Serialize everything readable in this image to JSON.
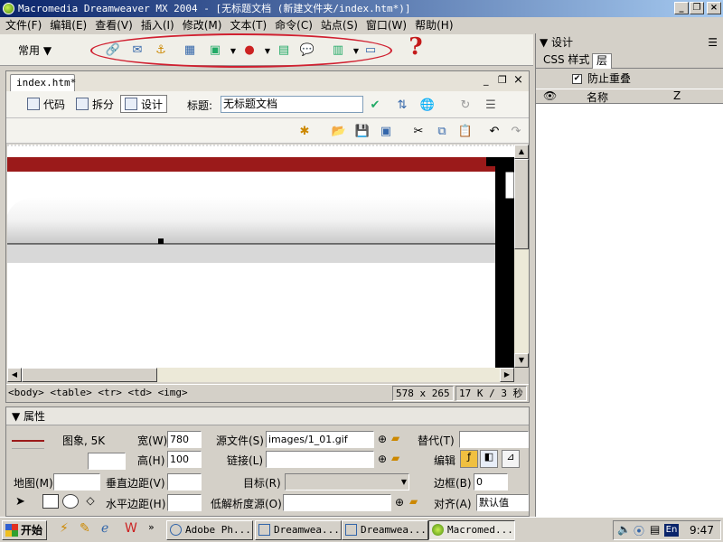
{
  "window": {
    "title": "Macromedia Dreamweaver MX 2004 - [无标题文档 (新建文件夹/index.htm*)]"
  },
  "menu": [
    "文件(F)",
    "编辑(E)",
    "查看(V)",
    "插入(I)",
    "修改(M)",
    "文本(T)",
    "命令(C)",
    "站点(S)",
    "窗口(W)",
    "帮助(H)"
  ],
  "insert_bar": {
    "category": "常用"
  },
  "document": {
    "tab": "index.htm*",
    "views": {
      "code": "代码",
      "split": "拆分",
      "design": "设计"
    },
    "title_label": "标题:",
    "title_value": "无标题文档",
    "tag_selector": "<body> <table> <tr> <td> <img>",
    "size": "578 x 265",
    "filesize": "17 K / 3 秒"
  },
  "properties": {
    "header": "属性",
    "kind": "图象, 5K",
    "width_label": "宽(W)",
    "width": "780",
    "height_label": "高(H)",
    "height": "100",
    "src_label": "源文件(S)",
    "src": "images/1_01.gif",
    "alt_label": "替代(T)",
    "link_label": "链接(L)",
    "edit_label": "编辑",
    "map_label": "地图(M)",
    "vspace_label": "垂直边距(V)",
    "target_label": "目标(R)",
    "border_label": "边框(B)",
    "border": "0",
    "hspace_label": "水平边距(H)",
    "lowsrc_label": "低解析度源(O)",
    "align_label": "对齐(A)",
    "align": "默认值"
  },
  "panel": {
    "title": "设计",
    "tabs": [
      "CSS 样式",
      "层"
    ],
    "prevent_overlap": "防止重叠",
    "col_name": "名称",
    "col_z": "Z"
  },
  "taskbar": {
    "start": "开始",
    "tasks": [
      "Adobe Ph...",
      "Dreamwea...",
      "Dreamwea...",
      "Macromed..."
    ],
    "lang": "En",
    "clock": "9:47"
  },
  "colors": {
    "accent_red": "#9b1a1a",
    "highlight_circle": "#d02030",
    "title_blue": "#0a246a"
  }
}
